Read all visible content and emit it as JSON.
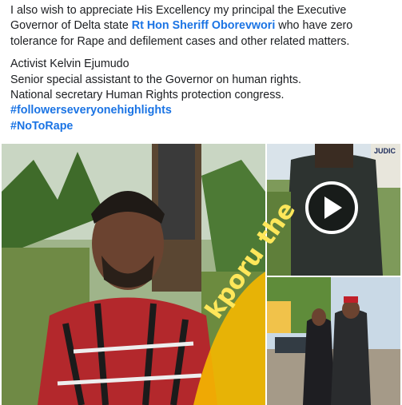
{
  "post": {
    "paragraph1": {
      "line1": "I also wish to appreciate His Excellency my principal the Executive",
      "line2_before": "Governor of Delta state ",
      "mention": "Rt Hon Sheriff Oborevwori",
      "line2_after": " who have zero",
      "line3": "tolerance for Rape and defilement cases and other related matters."
    },
    "paragraph2": {
      "line1": "Activist Kelvin Ejumudo",
      "line2": "Senior special assistant to the Governor on human rights.",
      "line3": "National secretary Human Rights protection congress."
    },
    "hashtags": [
      "#followerseveryonehighlights",
      "#NoToRape"
    ]
  },
  "media": {
    "main_photo": {
      "overlay_text": "kporu the"
    },
    "video_tile": {
      "sign_text": "JUDIC"
    },
    "third_photo": {}
  },
  "icons": {
    "video": "play-icon"
  },
  "colors": {
    "link": "#1b74e4",
    "text": "#1c1e21",
    "sticker": "#f5b700"
  }
}
